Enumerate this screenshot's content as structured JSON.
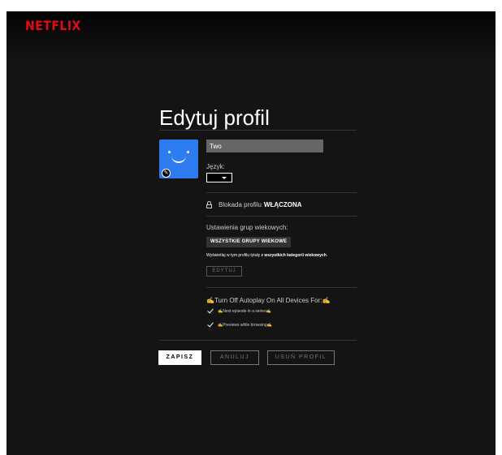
{
  "brand": {
    "logo": "NETFLIX",
    "logo_color": "#e50914"
  },
  "page": {
    "title": "Edytuj profil",
    "background": "#141414"
  },
  "profile": {
    "name_value": "Two",
    "avatar_color": "#2d7cf1",
    "avatar_icon": "smiley-face-icon",
    "edit_icon": "pencil-icon"
  },
  "language": {
    "label": "Język:",
    "selected": ""
  },
  "lock": {
    "label": "Blokada profilu",
    "status": "WŁĄCZONA",
    "icon": "lock-icon"
  },
  "maturity": {
    "label": "Ustawienia grup wiekowych:",
    "badge": "WSZYSTKIE GRUPY WIEKOWE",
    "desc_prefix": "Wyświetlaj w tym profilu tytuły ",
    "desc_bold": "z wszystkich kategorii wiekowych",
    "desc_suffix": ".",
    "edit_label": "EDYTUJ"
  },
  "autoplay": {
    "title": "✍Turn Off Autoplay On All Devices For:✍",
    "options": [
      {
        "label": "✍Next episode in a series✍",
        "checked": true
      },
      {
        "label": "✍Previews while browsing✍",
        "checked": true
      }
    ]
  },
  "actions": {
    "save": "ZAPISZ",
    "cancel": "ANULUJ",
    "delete": "USUŃ PROFIL"
  }
}
